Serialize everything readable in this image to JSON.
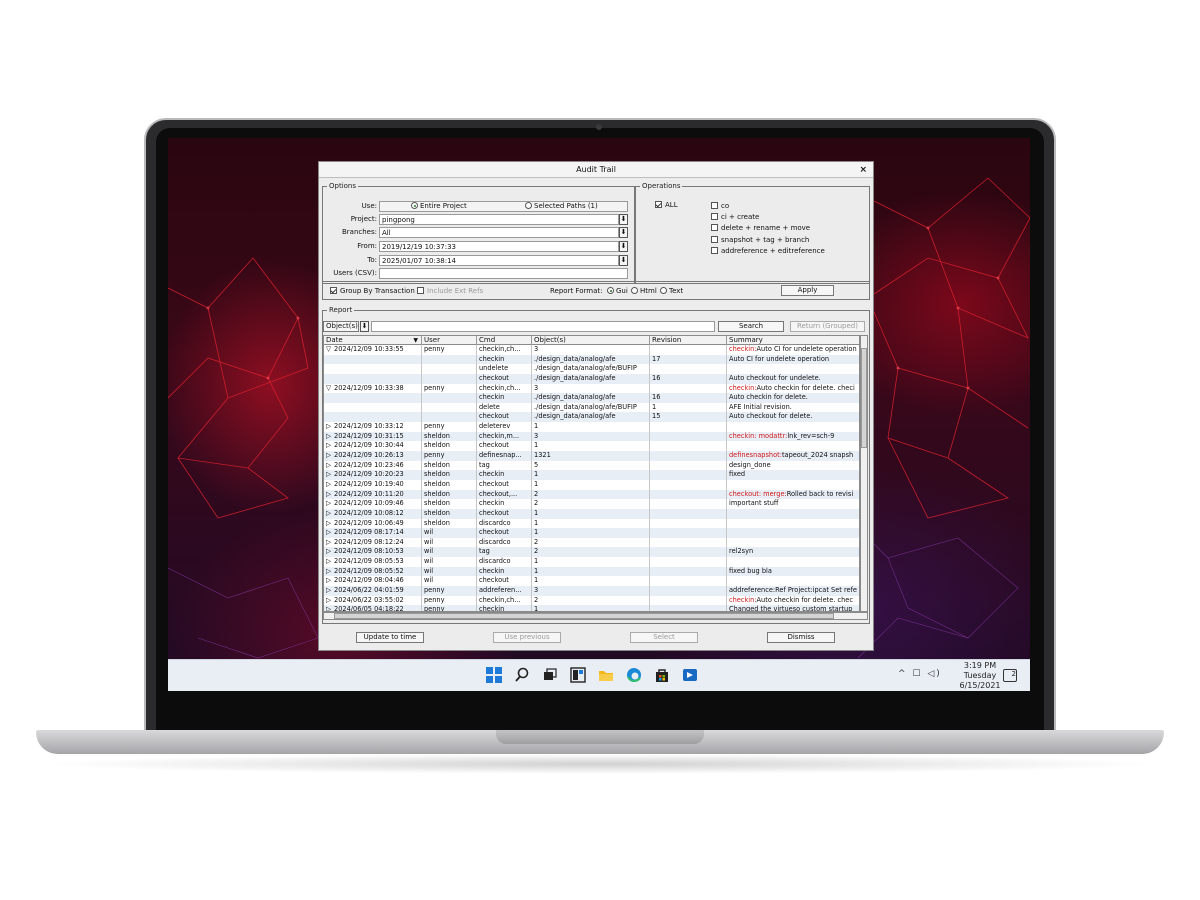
{
  "dialog": {
    "title": "Audit Trail",
    "close": "×",
    "options": {
      "legend": "Options",
      "use_label": "Use:",
      "use_entire": "Entire Project",
      "use_selected": "Selected Paths (1)",
      "project_label": "Project:",
      "project_value": "pingpong",
      "branches_label": "Branches:",
      "branches_value": "All",
      "from_label": "From:",
      "from_value": "2019/12/19 10:37:33",
      "to_label": "To:",
      "to_value": "2025/01/07 10:38:14",
      "users_label": "Users (CSV):",
      "users_value": "",
      "group_by": "Group By Transaction",
      "include_ext": "Include Ext Refs",
      "report_format_label": "Report Format:",
      "fmt_gui": "Gui",
      "fmt_html": "Html",
      "fmt_text": "Text",
      "apply": "Apply"
    },
    "operations": {
      "legend": "Operations",
      "all": "ALL",
      "items": [
        "co",
        "ci + create",
        "delete + rename + move",
        "snapshot + tag + branch",
        "addreference + editreference"
      ]
    },
    "report": {
      "legend": "Report",
      "object_dropdown": "Object(s)",
      "search_value": "",
      "search": "Search",
      "return_grouped": "Return (Grouped)",
      "columns": [
        "Date",
        "User",
        "Cmd",
        "Object(s)",
        "Revision",
        "Summary"
      ]
    },
    "footer": {
      "update": "Update to time",
      "use_previous": "Use previous",
      "select": "Select",
      "dismiss": "Dismiss"
    }
  },
  "rows": [
    {
      "exp": "▽",
      "date": "2024/12/09 10:33:55",
      "user": "penny",
      "cmd": "checkin,ch...",
      "obj": "3",
      "rev": "",
      "sr": "checkin:",
      "sb": "Auto CI for undelete operation"
    },
    {
      "exp": "",
      "date": "",
      "user": "",
      "cmd": "checkin",
      "obj": "./design_data/analog/afe",
      "rev": "17",
      "sr": "",
      "sb": "Auto CI for undelete operation"
    },
    {
      "exp": "",
      "date": "",
      "user": "",
      "cmd": "undelete",
      "obj": "./design_data/analog/afe/BUFIP",
      "rev": "",
      "sr": "",
      "sb": ""
    },
    {
      "exp": "",
      "date": "",
      "user": "",
      "cmd": "checkout",
      "obj": "./design_data/analog/afe",
      "rev": "16",
      "sr": "",
      "sb": "Auto checkout for undelete."
    },
    {
      "exp": "▽",
      "date": "2024/12/09 10:33:38",
      "user": "penny",
      "cmd": "checkin,ch...",
      "obj": "3",
      "rev": "",
      "sr": "checkin:",
      "sb": "Auto checkin for delete.  checi"
    },
    {
      "exp": "",
      "date": "",
      "user": "",
      "cmd": "checkin",
      "obj": "./design_data/analog/afe",
      "rev": "16",
      "sr": "",
      "sb": "Auto checkin for delete."
    },
    {
      "exp": "",
      "date": "",
      "user": "",
      "cmd": "delete",
      "obj": "./design_data/analog/afe/BUFIP",
      "rev": "1",
      "sr": "",
      "sb": "AFE Initial revision."
    },
    {
      "exp": "",
      "date": "",
      "user": "",
      "cmd": "checkout",
      "obj": "./design_data/analog/afe",
      "rev": "15",
      "sr": "",
      "sb": "Auto checkout for delete."
    },
    {
      "exp": "▷",
      "date": "2024/12/09 10:33:12",
      "user": "penny",
      "cmd": "deleterev",
      "obj": "1",
      "rev": "",
      "sr": "",
      "sb": ""
    },
    {
      "exp": "▷",
      "date": "2024/12/09 10:31:15",
      "user": "sheldon",
      "cmd": "checkin,m...",
      "obj": "3",
      "rev": "",
      "sr": "checkin:  modattr:",
      "sb": "lnk_rev=sch-9"
    },
    {
      "exp": "▷",
      "date": "2024/12/09 10:30:44",
      "user": "sheldon",
      "cmd": "checkout",
      "obj": "1",
      "rev": "",
      "sr": "",
      "sb": ""
    },
    {
      "exp": "▷",
      "date": "2024/12/09 10:26:13",
      "user": "penny",
      "cmd": "definesnap...",
      "obj": "1321",
      "rev": "",
      "sr": "definesnapshot:",
      "sb": "tapeout_2024  snapsh"
    },
    {
      "exp": "▷",
      "date": "2024/12/09 10:23:46",
      "user": "sheldon",
      "cmd": "tag",
      "obj": "5",
      "rev": "",
      "sr": "",
      "sb": "design_done"
    },
    {
      "exp": "▷",
      "date": "2024/12/09 10:20:23",
      "user": "sheldon",
      "cmd": "checkin",
      "obj": "1",
      "rev": "",
      "sr": "",
      "sb": "fixed"
    },
    {
      "exp": "▷",
      "date": "2024/12/09 10:19:40",
      "user": "sheldon",
      "cmd": "checkout",
      "obj": "1",
      "rev": "",
      "sr": "",
      "sb": ""
    },
    {
      "exp": "▷",
      "date": "2024/12/09 10:11:20",
      "user": "sheldon",
      "cmd": "checkout,...",
      "obj": "2",
      "rev": "",
      "sr": "checkout:  merge:",
      "sb": "Rolled back to revisi"
    },
    {
      "exp": "▷",
      "date": "2024/12/09 10:09:46",
      "user": "sheldon",
      "cmd": "checkin",
      "obj": "2",
      "rev": "",
      "sr": "",
      "sb": "important stuff"
    },
    {
      "exp": "▷",
      "date": "2024/12/09 10:08:12",
      "user": "sheldon",
      "cmd": "checkout",
      "obj": "1",
      "rev": "",
      "sr": "",
      "sb": ""
    },
    {
      "exp": "▷",
      "date": "2024/12/09 10:06:49",
      "user": "sheldon",
      "cmd": "discardco",
      "obj": "1",
      "rev": "",
      "sr": "",
      "sb": ""
    },
    {
      "exp": "▷",
      "date": "2024/12/09 08:17:14",
      "user": "wil",
      "cmd": "checkout",
      "obj": "1",
      "rev": "",
      "sr": "",
      "sb": ""
    },
    {
      "exp": "▷",
      "date": "2024/12/09 08:12:24",
      "user": "wil",
      "cmd": "discardco",
      "obj": "2",
      "rev": "",
      "sr": "",
      "sb": ""
    },
    {
      "exp": "▷",
      "date": "2024/12/09 08:10:53",
      "user": "wil",
      "cmd": "tag",
      "obj": "2",
      "rev": "",
      "sr": "",
      "sb": "rel2syn"
    },
    {
      "exp": "▷",
      "date": "2024/12/09 08:05:53",
      "user": "wil",
      "cmd": "discardco",
      "obj": "1",
      "rev": "",
      "sr": "",
      "sb": ""
    },
    {
      "exp": "▷",
      "date": "2024/12/09 08:05:52",
      "user": "wil",
      "cmd": "checkin",
      "obj": "1",
      "rev": "",
      "sr": "",
      "sb": "fixed bug bla"
    },
    {
      "exp": "▷",
      "date": "2024/12/09 08:04:46",
      "user": "wil",
      "cmd": "checkout",
      "obj": "1",
      "rev": "",
      "sr": "",
      "sb": ""
    },
    {
      "exp": "▷",
      "date": "2024/06/22 04:01:59",
      "user": "penny",
      "cmd": "addreferen...",
      "obj": "3",
      "rev": "",
      "sr": "",
      "sb": "addreference:Ref Project:ipcat Set refe"
    },
    {
      "exp": "▷",
      "date": "2024/06/22 03:55:02",
      "user": "penny",
      "cmd": "checkin,ch...",
      "obj": "2",
      "rev": "",
      "sr": "checkin:",
      "sb": "Auto checkin for delete.  chec"
    },
    {
      "exp": "▷",
      "date": "2024/06/05 04:18:22",
      "user": "penny",
      "cmd": "checkin",
      "obj": "1",
      "rev": "",
      "sr": "",
      "sb": "Changed the virtueso custom startup"
    }
  ],
  "taskbar": {
    "icons": [
      "start-icon",
      "search-icon",
      "taskview-icon",
      "widgets-icon",
      "file-explorer-icon",
      "edge-icon",
      "store-icon",
      "app-icon"
    ],
    "time": "3:19 PM",
    "day": "Tuesday",
    "date": "6/15/2021",
    "notif_count": "2"
  }
}
